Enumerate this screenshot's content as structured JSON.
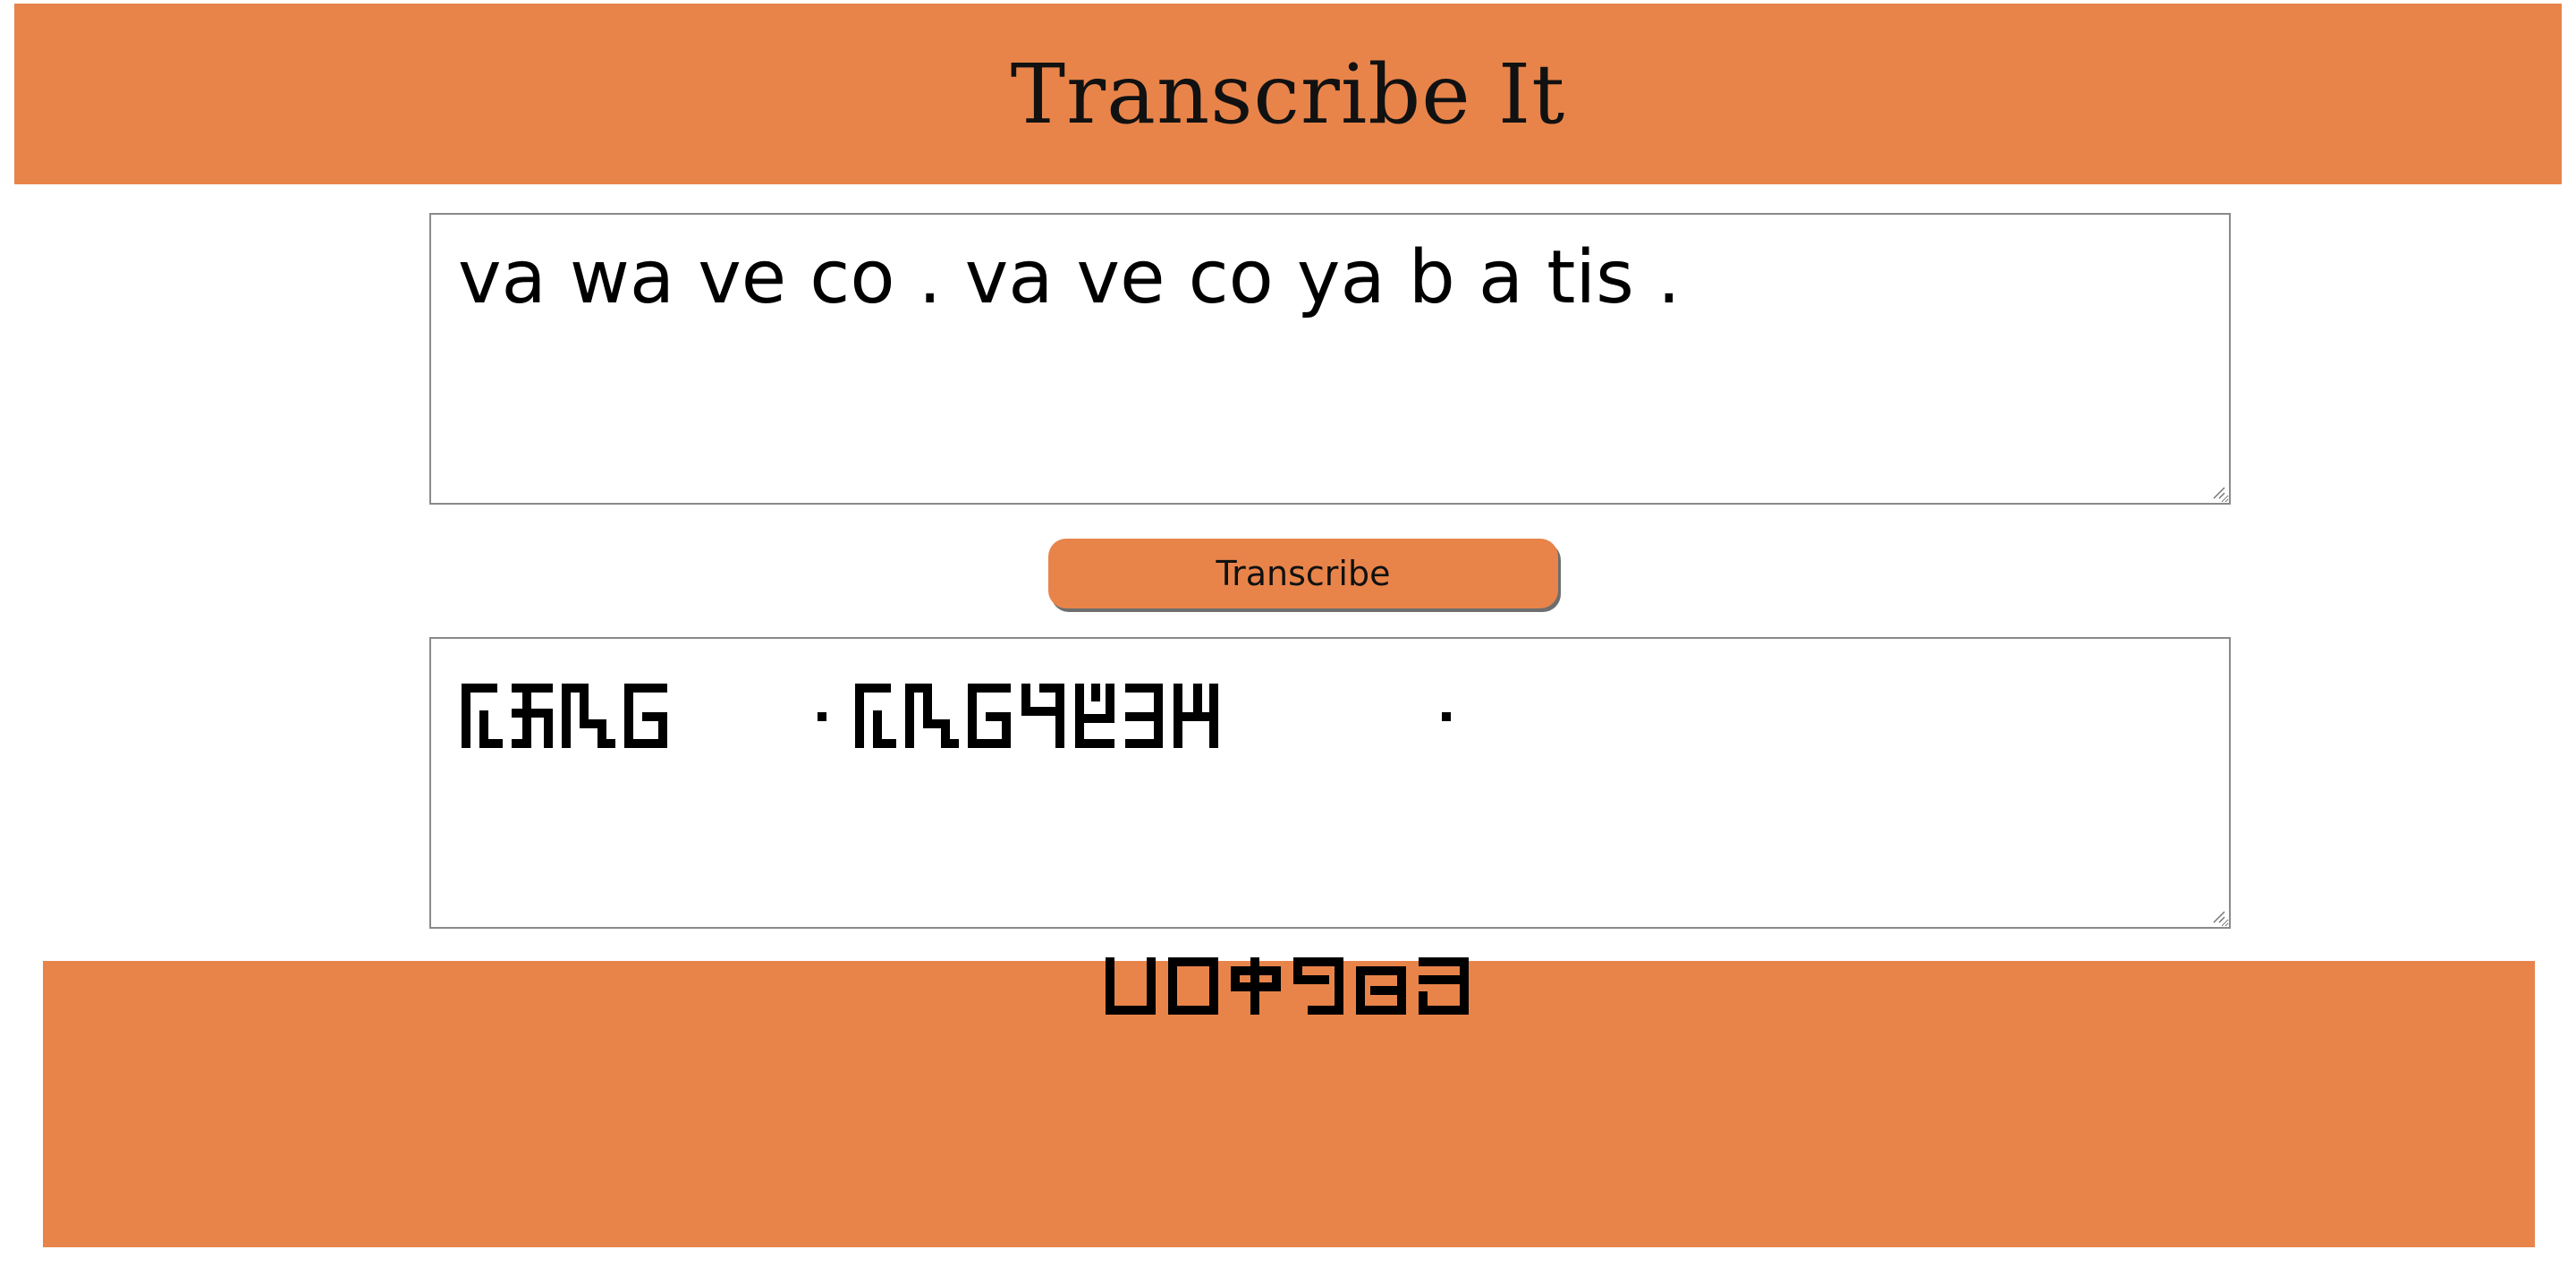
{
  "header": {
    "title": "Transcribe It"
  },
  "input": {
    "value": "va wa ve co . va ve co ya b a tis ."
  },
  "button": {
    "label": "Transcribe"
  },
  "output": {
    "glyph_words": [
      [
        "va",
        "wa",
        "ve",
        "co"
      ],
      [
        "va",
        "ve",
        "co",
        "ya",
        "b",
        "a",
        "tis"
      ]
    ],
    "separator": "·"
  },
  "footer": {
    "glyphs": [
      "footer-glyph-1",
      "footer-glyph-2",
      "footer-glyph-3",
      "footer-glyph-4",
      "footer-glyph-5",
      "footer-glyph-6"
    ]
  },
  "colors": {
    "accent": "#e8844a",
    "text": "#000000",
    "border": "#8a8a8a"
  }
}
